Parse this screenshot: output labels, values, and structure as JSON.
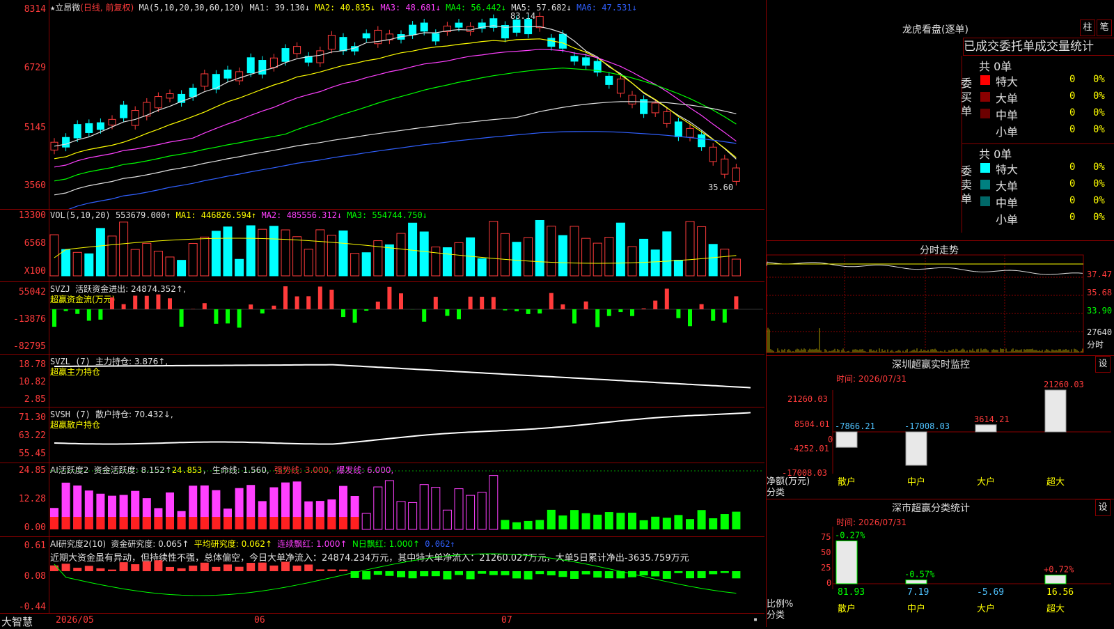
{
  "header": {
    "price_top": "8314",
    "stock_name": "立昂微",
    "mode": "(日线, 前复权)",
    "ma_label": "MA(5,10,20,30,60,120)",
    "ma1": "MA1: 39.130↓",
    "ma2": "MA2: 40.835↓",
    "ma3": "MA3: 48.681↓",
    "ma4": "MA4: 56.442↓",
    "ma5": "MA5: 57.682↓",
    "ma6": "MA6: 47.531↓",
    "high_mark": "83.14",
    "low_mark": "35.60"
  },
  "price_axis": [
    "8314",
    "6729",
    "5145",
    "3560"
  ],
  "vol": {
    "title": "VOL(5,10,20)",
    "value": "553679.000↑",
    "ma1": "MA1: 446826.594↑",
    "ma2": "MA2: 485556.312↓",
    "ma3": "MA3: 554744.750↓",
    "axis": [
      "13300",
      "6568",
      "X100"
    ]
  },
  "svzj": {
    "title": "SVZJ",
    "label": "活跃资金进出: 24874.352↑,",
    "note": "超赢资金流(万元)",
    "axis": [
      "55042",
      "-13876",
      "-82795"
    ]
  },
  "svzl": {
    "title": "SVZL (7)",
    "label": "主力持仓: 3.876↑,",
    "note": "超赢主力持仓",
    "axis": [
      "18.78",
      "10.82",
      "2.85"
    ]
  },
  "svsh": {
    "title": "SVSH (7)",
    "label": "散户持仓: 70.432↓,",
    "note": "超赢散户持仓",
    "axis": [
      "71.30",
      "63.22",
      "55.45"
    ]
  },
  "ai1": {
    "title": "AI活跃度2",
    "label": "资金活跃度: 8.152↑",
    "v2": "24.853",
    "life": "生命线: 1.560,",
    "strong": "强势线: 3.000,",
    "burst": "爆发线: 6.000,",
    "axis": [
      "24.85",
      "12.28",
      "0.00"
    ]
  },
  "ai2": {
    "title": "AI研究度2(10)",
    "label": "资金研究度: 0.065↑",
    "avg": "平均研究度: 0.062↑",
    "cont": "连续飘红: 1.000↑",
    "nday": "N日飘红: 1.000↑",
    "v5": "0.062↑",
    "text": "近期大资金虽有异动，但持续性不强，总体偏空，今日大单净流入：24874.234万元，其中特大单净流入：21260.027万元，大单5日累计净出-3635.759万元",
    "axis": [
      "0.61",
      "0.08",
      "-0.44"
    ]
  },
  "bottom": {
    "brand": "大智慧",
    "dates": [
      "2026/05",
      "06",
      "07"
    ]
  },
  "lhb": {
    "title": "龙虎看盘(逐单)",
    "btn1": "柱",
    "btn2": "笔",
    "subtitle": "已成交委托单成交量统计",
    "buy_total": "共 0单",
    "buy_side": [
      "委",
      "买",
      "单"
    ],
    "sell_total": "共 0单",
    "sell_side": [
      "委",
      "卖",
      "单"
    ],
    "buy_rows": [
      {
        "name": "特大",
        "val": "0",
        "pct": "0%"
      },
      {
        "name": "大单",
        "val": "0",
        "pct": "0%"
      },
      {
        "name": "中单",
        "val": "0",
        "pct": "0%"
      },
      {
        "name": "小单",
        "val": "0",
        "pct": "0%"
      }
    ],
    "sell_rows": [
      {
        "name": "特大",
        "val": "0",
        "pct": "0%"
      },
      {
        "name": "大单",
        "val": "0",
        "pct": "0%"
      },
      {
        "name": "中单",
        "val": "0",
        "pct": "0%"
      },
      {
        "name": "小单",
        "val": "0",
        "pct": "0%"
      }
    ]
  },
  "intraday": {
    "title": "分时走势",
    "axis": [
      "37.47",
      "35.68",
      "33.90",
      "27640"
    ],
    "unit": "分时"
  },
  "sz_monitor": {
    "title": "深圳超赢实时监控",
    "btn": "设",
    "time": "时间: 2026/07/31",
    "axis": [
      "21260.03",
      "8504.01",
      "0",
      "-4252.01",
      "-17008.03"
    ],
    "ylabel": "净额(万元)",
    "xlabel": "分类",
    "categories": [
      "散户",
      "中户",
      "大户",
      "超大"
    ],
    "values": [
      -7866.21,
      -17008.03,
      3614.21,
      21260.03
    ],
    "value_labels": [
      "-7866.21",
      "-17008.03",
      "3614.21",
      "21260.03"
    ]
  },
  "sc_stats": {
    "title": "深市超赢分类统计",
    "btn": "设",
    "time": "时间: 2026/07/31",
    "axis": [
      "75",
      "50",
      "25",
      "0"
    ],
    "ylabel": "比例%",
    "xlabel": "分类",
    "categories": [
      "散户",
      "中户",
      "大户",
      "超大"
    ],
    "values": [
      81.93,
      7.19,
      -5.69,
      16.56
    ],
    "top_labels": [
      "-0.27%",
      "-0.57%",
      "",
      "+0.72%"
    ],
    "bottom_labels": [
      "81.93",
      "7.19",
      "-5.69",
      "16.56"
    ]
  },
  "colors": {
    "up": "#ff3b3b",
    "down": "#00ffff",
    "grid": "#8a0000"
  }
}
